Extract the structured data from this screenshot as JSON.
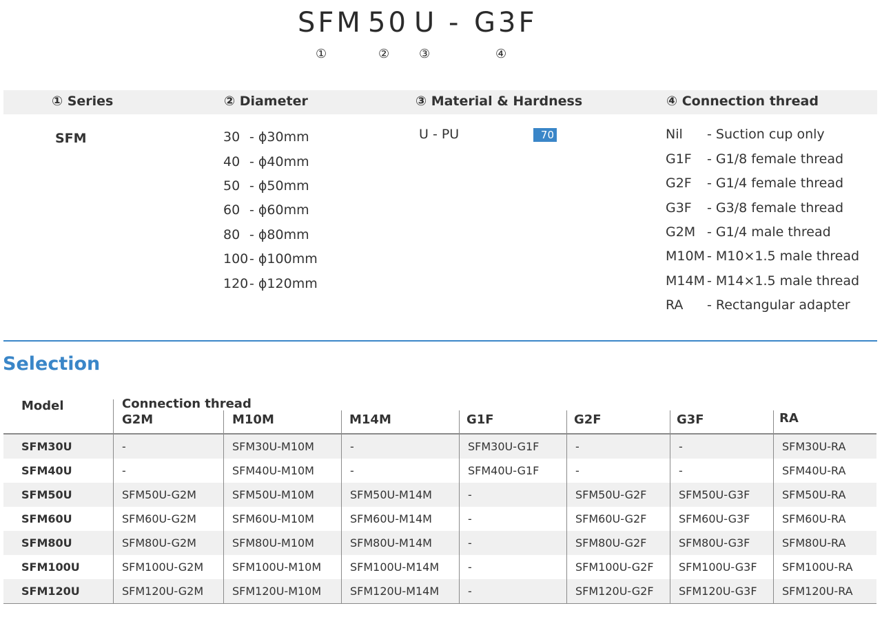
{
  "model_code": {
    "parts": [
      "SFM",
      "50",
      "U",
      "-",
      "G3F"
    ],
    "markers": [
      "①",
      "②",
      "③",
      "④"
    ]
  },
  "spec": {
    "headers": [
      "① Series",
      "② Diameter",
      "③ Material & Hardness",
      "④ Connection thread"
    ],
    "series": "SFM",
    "diameters": [
      {
        "code": "30",
        "desc": "- ϕ30mm"
      },
      {
        "code": "40",
        "desc": "- ϕ40mm"
      },
      {
        "code": "50",
        "desc": "- ϕ50mm"
      },
      {
        "code": "60",
        "desc": "- ϕ60mm"
      },
      {
        "code": "80",
        "desc": "- ϕ80mm"
      },
      {
        "code": "100",
        "desc": "- ϕ100mm"
      },
      {
        "code": "120",
        "desc": "- ϕ120mm"
      }
    ],
    "material": "U - PU",
    "hardness": "70",
    "threads": [
      {
        "code": "Nil",
        "desc": "- Suction cup only"
      },
      {
        "code": "G1F",
        "desc": "- G1/8 female thread"
      },
      {
        "code": "G2F",
        "desc": "- G1/4 female thread"
      },
      {
        "code": "G3F",
        "desc": "- G3/8 female thread"
      },
      {
        "code": "G2M",
        "desc": "- G1/4 male thread"
      },
      {
        "code": "M10M",
        "desc": "- M10×1.5 male thread"
      },
      {
        "code": "M14M",
        "desc": "- M14×1.5 male thread"
      },
      {
        "code": "RA",
        "desc": "- Rectangular adapter"
      }
    ]
  },
  "selection": {
    "title": "Selection",
    "model_header": "Model",
    "group_header": "Connection thread",
    "columns": [
      "G2M",
      "M10M",
      "M14M",
      "G1F",
      "G2F",
      "G3F",
      "RA"
    ],
    "rows": [
      {
        "model": "SFM30U",
        "cells": [
          "-",
          "SFM30U-M10M",
          "-",
          "SFM30U-G1F",
          "-",
          "-",
          "SFM30U-RA"
        ]
      },
      {
        "model": "SFM40U",
        "cells": [
          "-",
          "SFM40U-M10M",
          "-",
          "SFM40U-G1F",
          "-",
          "-",
          "SFM40U-RA"
        ]
      },
      {
        "model": "SFM50U",
        "cells": [
          "SFM50U-G2M",
          "SFM50U-M10M",
          "SFM50U-M14M",
          "-",
          "SFM50U-G2F",
          "SFM50U-G3F",
          "SFM50U-RA"
        ]
      },
      {
        "model": "SFM60U",
        "cells": [
          "SFM60U-G2M",
          "SFM60U-M10M",
          "SFM60U-M14M",
          "-",
          "SFM60U-G2F",
          "SFM60U-G3F",
          "SFM60U-RA"
        ]
      },
      {
        "model": "SFM80U",
        "cells": [
          "SFM80U-G2M",
          "SFM80U-M10M",
          "SFM80U-M14M",
          "-",
          "SFM80U-G2F",
          "SFM80U-G3F",
          "SFM80U-RA"
        ]
      },
      {
        "model": "SFM100U",
        "cells": [
          "SFM100U-G2M",
          "SFM100U-M10M",
          "SFM100U-M14M",
          "-",
          "SFM100U-G2F",
          "SFM100U-G3F",
          "SFM100U-RA"
        ]
      },
      {
        "model": "SFM120U",
        "cells": [
          "SFM120U-G2M",
          "SFM120U-M10M",
          "SFM120U-M14M",
          "-",
          "SFM120U-G2F",
          "SFM120U-G3F",
          "SFM120U-RA"
        ]
      }
    ]
  },
  "colors": {
    "accent": "#3a86c8",
    "header_bg": "#f0f0f0",
    "rule": "#8a8a8a"
  }
}
